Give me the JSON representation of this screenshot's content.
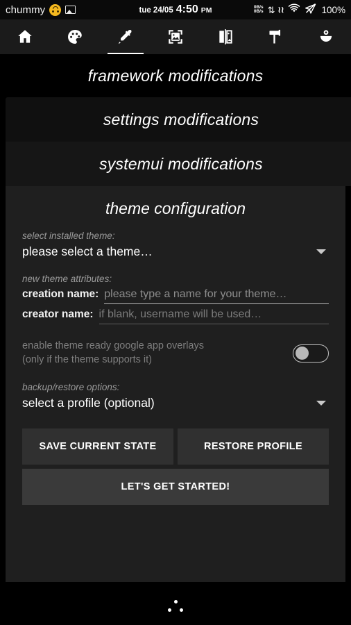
{
  "status_bar": {
    "user_name": "chummy",
    "emoji_icon": "upside-down-face-emoji",
    "photo_icon": "image-icon",
    "date": "tue 24/05",
    "time": "4:50",
    "am_pm": "PM",
    "net_speed_down": "0B/s",
    "net_speed_up": "0B/s",
    "data_arrows_icon": "up-down-arrows-icon",
    "wave_icon": "signal-wave-icon",
    "wifi_icon": "wifi-icon",
    "location_icon": "location-off-icon",
    "battery_percent": "100%"
  },
  "toolbar": {
    "tabs": [
      {
        "name": "home",
        "icon": "home-icon",
        "active": false
      },
      {
        "name": "colors",
        "icon": "palette-icon",
        "active": false
      },
      {
        "name": "themes",
        "icon": "eyedropper-icon",
        "active": true
      },
      {
        "name": "wallpapers",
        "icon": "image-frame-icon",
        "active": false
      },
      {
        "name": "compare",
        "icon": "split-compare-icon",
        "active": false
      },
      {
        "name": "paint",
        "icon": "paint-roller-icon",
        "active": false
      },
      {
        "name": "flower",
        "icon": "flower-vase-icon",
        "active": false
      }
    ]
  },
  "sections": {
    "framework": "framework modifications",
    "settings": "settings modifications",
    "systemui": "systemui modifications",
    "theme_config_title": "theme configuration"
  },
  "theme_config": {
    "select_theme_label": "select installed theme:",
    "select_theme_value": "please select a theme…",
    "new_attributes_label": "new theme attributes:",
    "creation_name_label": "creation name:",
    "creation_name_value": "",
    "creation_name_placeholder": "please type a name for your theme…",
    "creator_name_label": "creator name:",
    "creator_name_value": "",
    "creator_name_placeholder": "if blank, username will be used…",
    "overlays_toggle_line1": "enable theme ready google app overlays",
    "overlays_toggle_line2": "(only if the theme supports it)",
    "overlays_toggle_state": "off",
    "backup_label": "backup/restore options:",
    "backup_value": "select a profile (optional)",
    "save_button": "SAVE CURRENT STATE",
    "restore_button": "RESTORE PROFILE",
    "start_button": "LET'S GET STARTED!"
  },
  "nav": {
    "dots_icon": "three-dots-nav-icon"
  },
  "colors": {
    "background": "#000000",
    "toolbar_bg": "#1b1b1b",
    "card_settings": "#101010",
    "card_systemui": "#161616",
    "card_config": "#1f1f1f",
    "button_bg": "#303030",
    "button_primary_bg": "#3a3a3a",
    "accent_text": "#ffffff",
    "muted_text": "#9a9a9a",
    "emoji_yellow": "#f6b91f"
  }
}
